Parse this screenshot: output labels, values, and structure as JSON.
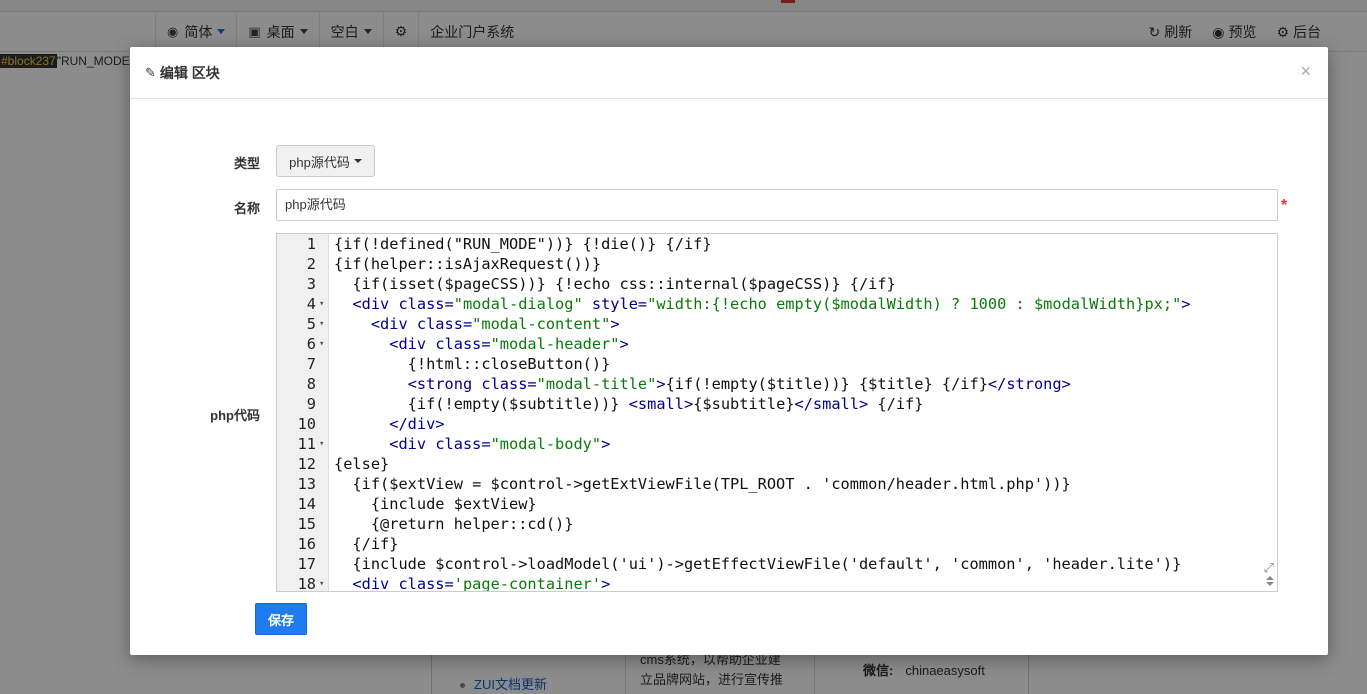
{
  "topbar": {
    "language": "简体",
    "device": "桌面",
    "layout": "空白",
    "breadcrumb": "企业门户系统",
    "refresh": "刷新",
    "preview": "预览",
    "admin": "后台"
  },
  "background": {
    "block_id": "#block237",
    "block_text": "\"RUN_MODE",
    "link_item": "ZUI文档更新",
    "cms_line1": "cms系统，以帮助企业建",
    "cms_line2": "立品牌网站，进行宣传推",
    "wechat_label": "微信:",
    "wechat_value": "chinaeasysoft"
  },
  "modal": {
    "title": "编辑 区块",
    "close": "×",
    "type_label": "类型",
    "type_value": "php源代码",
    "name_label": "名称",
    "name_value": "php源代码",
    "required_mark": "*",
    "code_label": "php代码",
    "save_label": "保存"
  },
  "editor": {
    "lines": [
      {
        "n": "1",
        "fold": false,
        "text": "{if(!defined(\"RUN_MODE\"))} {!die()} {/if}"
      },
      {
        "n": "2",
        "fold": false,
        "text": "{if(helper::isAjaxRequest())}"
      },
      {
        "n": "3",
        "fold": false,
        "text": "  {if(isset($pageCSS))} {!echo css::internal($pageCSS)} {/if}"
      },
      {
        "n": "4",
        "fold": true,
        "text": "  <div class=\"modal-dialog\" style=\"width:{!echo empty($modalWidth) ? 1000 : $modalWidth}px;\">"
      },
      {
        "n": "5",
        "fold": true,
        "text": "    <div class=\"modal-content\">"
      },
      {
        "n": "6",
        "fold": true,
        "text": "      <div class=\"modal-header\">"
      },
      {
        "n": "7",
        "fold": false,
        "text": "        {!html::closeButton()}"
      },
      {
        "n": "8",
        "fold": false,
        "text": "        <strong class=\"modal-title\">{if(!empty($title))} {$title} {/if}</strong>"
      },
      {
        "n": "9",
        "fold": false,
        "text": "        {if(!empty($subtitle))} <small>{$subtitle}</small> {/if}"
      },
      {
        "n": "10",
        "fold": false,
        "text": "      </div>"
      },
      {
        "n": "11",
        "fold": true,
        "text": "      <div class=\"modal-body\">"
      },
      {
        "n": "12",
        "fold": false,
        "text": "{else}"
      },
      {
        "n": "13",
        "fold": false,
        "text": "  {if($extView = $control->getExtViewFile(TPL_ROOT . 'common/header.html.php'))}"
      },
      {
        "n": "14",
        "fold": false,
        "text": "    {include $extView}"
      },
      {
        "n": "15",
        "fold": false,
        "text": "    {@return helper::cd()}"
      },
      {
        "n": "16",
        "fold": false,
        "text": "  {/if}"
      },
      {
        "n": "17",
        "fold": false,
        "text": "  {include $control->loadModel('ui')->getEffectViewFile('default', 'common', 'header.lite')}"
      },
      {
        "n": "18",
        "fold": true,
        "text": "  <div class='page-container'>"
      }
    ]
  },
  "icons": {
    "pencil": "pencil-icon",
    "close": "close-icon",
    "refresh": "refresh-icon",
    "preview": "eye-icon",
    "admin": "gears-icon",
    "settings": "gear-icon",
    "device": "monitor-icon"
  },
  "colors": {
    "primary": "#1e7cf0",
    "required": "#e2372f",
    "code_tag": "#00008b",
    "code_string": "#0a7a0a"
  }
}
